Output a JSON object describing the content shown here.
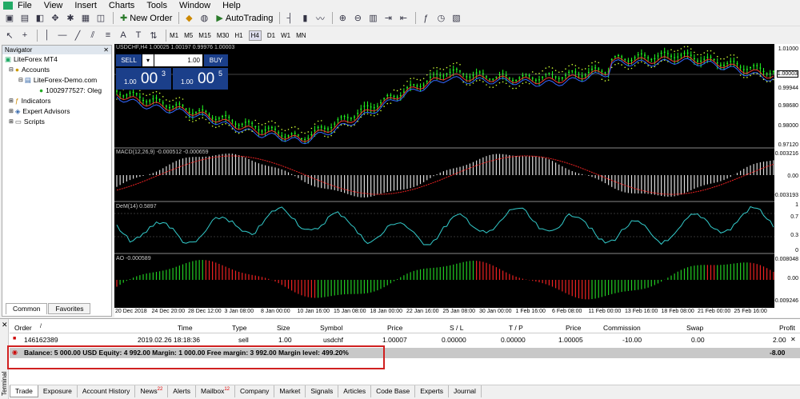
{
  "menu": [
    "File",
    "View",
    "Insert",
    "Charts",
    "Tools",
    "Window",
    "Help"
  ],
  "toolbar": {
    "new_order": "New Order",
    "autotrading": "AutoTrading"
  },
  "timeframes": [
    "M1",
    "M5",
    "M15",
    "M30",
    "H1",
    "H4",
    "D1",
    "W1",
    "MN"
  ],
  "active_timeframe": "H4",
  "navigator": {
    "title": "Navigator",
    "items": [
      {
        "label": "LiteForex MT4",
        "level": 0
      },
      {
        "label": "Accounts",
        "level": 1
      },
      {
        "label": "LiteForex-Demo.com",
        "level": 2
      },
      {
        "label": "1002977527: Oleg",
        "level": 3
      },
      {
        "label": "Indicators",
        "level": 1
      },
      {
        "label": "Expert Advisors",
        "level": 1
      },
      {
        "label": "Scripts",
        "level": 1
      }
    ],
    "tabs": [
      "Common",
      "Favorites"
    ]
  },
  "chart": {
    "symbol_label": "USDCHF,H4  1.00025 1.00197 0.99976 1.00003",
    "macd_label": "MACD(12,26,9) -0.000512 -0.000659",
    "dem_label": "DeM(14) 0.5897",
    "ao_label": "AO -0.000589",
    "price_ticks": [
      "1.01000",
      "1.00003",
      "0.99944",
      "0.98680",
      "0.98000",
      "0.97120"
    ],
    "macd_ticks": [
      "0.003216",
      "0.00",
      "-0.003193"
    ],
    "dem_ticks": [
      "1",
      "0.7",
      "0.3",
      "0"
    ],
    "ao_ticks": [
      "0.008048",
      "0.00",
      "-0.009246"
    ],
    "time_ticks": [
      "20 Dec 2018",
      "24 Dec 20:00",
      "28 Dec 12:00",
      "3 Jan 08:00",
      "8 Jan 00:00",
      "10 Jan 16:00",
      "15 Jan 08:00",
      "18 Jan 00:00",
      "22 Jan 16:00",
      "25 Jan 08:00",
      "30 Jan 00:00",
      "1 Feb 16:00",
      "6 Feb 08:00",
      "11 Feb 00:00",
      "13 Feb 16:00",
      "18 Feb 08:00",
      "21 Feb 00:00",
      "25 Feb 16:00"
    ],
    "oneclick": {
      "sell": "SELL",
      "buy": "BUY",
      "lot": "1.00",
      "bid_small": "1.00",
      "bid_big": "00",
      "bid_sup": "3",
      "ask_small": "1.00",
      "ask_big": "00",
      "ask_sup": "5"
    }
  },
  "terminal": {
    "side_label": "Terminal",
    "headers": [
      "Order",
      "Time",
      "Type",
      "Size",
      "Symbol",
      "Price",
      "S / L",
      "T / P",
      "Price",
      "Commission",
      "Swap",
      "Profit"
    ],
    "row": [
      "146162389",
      "2019.02.26 18:18:36",
      "sell",
      "1.00",
      "usdchf",
      "1.00007",
      "0.00000",
      "0.00000",
      "1.00005",
      "-10.00",
      "0.00",
      "2.00"
    ],
    "balance": "Balance: 5 000.00 USD  Equity: 4 992.00  Margin: 1 000.00  Free margin: 3 992.00  Margin level: 499.20%",
    "balance_profit": "-8.00",
    "tabs": [
      {
        "label": "Trade"
      },
      {
        "label": "Exposure"
      },
      {
        "label": "Account History"
      },
      {
        "label": "News",
        "badge": "22"
      },
      {
        "label": "Alerts"
      },
      {
        "label": "Mailbox",
        "badge": "12"
      },
      {
        "label": "Company"
      },
      {
        "label": "Market"
      },
      {
        "label": "Signals"
      },
      {
        "label": "Articles"
      },
      {
        "label": "Code Base"
      },
      {
        "label": "Experts"
      },
      {
        "label": "Journal"
      }
    ]
  }
}
